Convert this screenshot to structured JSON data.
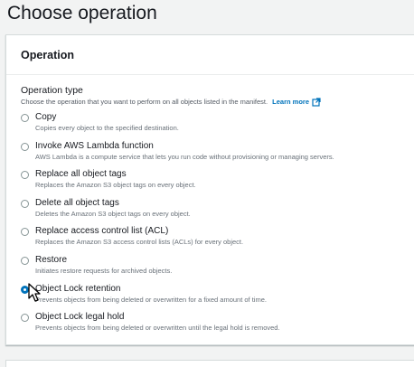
{
  "page": {
    "title": "Choose operation"
  },
  "panel": {
    "title": "Operation",
    "field_label": "Operation type",
    "field_description": "Choose the operation that you want to perform on all objects listed in the manifest.",
    "learn_more": "Learn more",
    "selected_index": 6,
    "options": [
      {
        "label": "Copy",
        "description": "Copies every object to the specified destination."
      },
      {
        "label": "Invoke AWS Lambda function",
        "description": "AWS Lambda is a compute service that lets you run code without provisioning or managing servers."
      },
      {
        "label": "Replace all object tags",
        "description": "Replaces the Amazon S3 object tags on every object."
      },
      {
        "label": "Delete all object tags",
        "description": "Deletes the Amazon S3 object tags on every object."
      },
      {
        "label": "Replace access control list (ACL)",
        "description": "Replaces the Amazon S3 access control lists (ACLs) for every object."
      },
      {
        "label": "Restore",
        "description": "Initiates restore requests for archived objects."
      },
      {
        "label": "Object Lock retention",
        "description": "Prevents objects from being deleted or overwritten for a fixed amount of time."
      },
      {
        "label": "Object Lock legal hold",
        "description": "Prevents objects from being deleted or overwritten until the legal hold is removed."
      }
    ]
  },
  "colors": {
    "accent": "#0073bb",
    "link": "#0073bb",
    "muted_text": "#687078"
  },
  "icons": {
    "learn_more": "external-link-icon",
    "cursor": "mouse-pointer-icon"
  }
}
